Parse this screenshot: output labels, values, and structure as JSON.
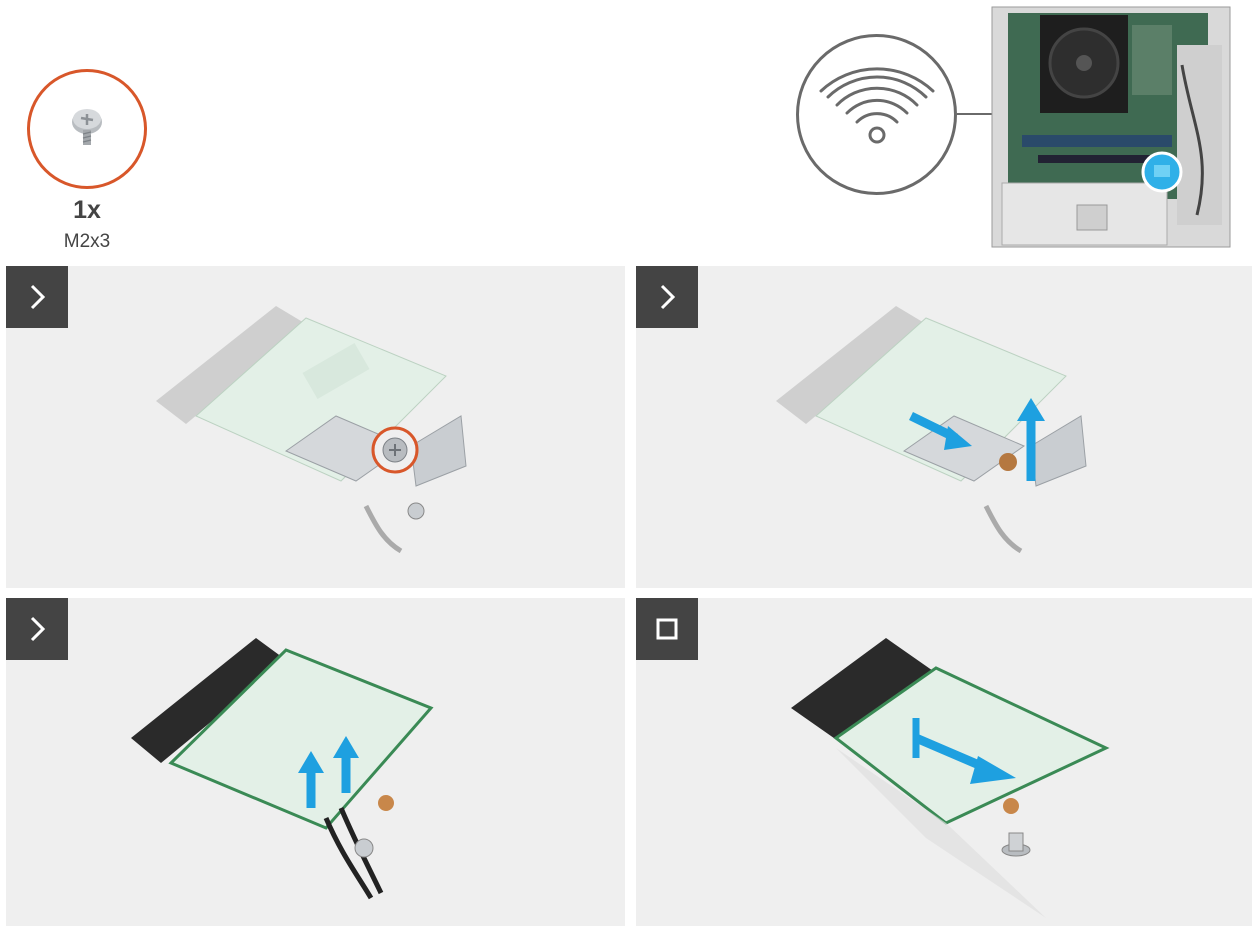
{
  "screw": {
    "quantity": "1x",
    "size": "M2x3",
    "icon": "screw-icon",
    "ring_color": "#d8572a"
  },
  "overview": {
    "icon": "wifi-icon",
    "callout_color": "#6a6a6a",
    "highlight_color": "#1ea0e0"
  },
  "steps": [
    {
      "marker": "next-step-icon"
    },
    {
      "marker": "next-step-icon"
    },
    {
      "marker": "next-step-icon"
    },
    {
      "marker": "final-step-icon"
    }
  ],
  "colors": {
    "marker_bg": "#444444",
    "panel_bg": "#efefef",
    "arrow": "#1ea0e0",
    "card": "#d9ecdf",
    "connector": "#2a2a2a"
  }
}
